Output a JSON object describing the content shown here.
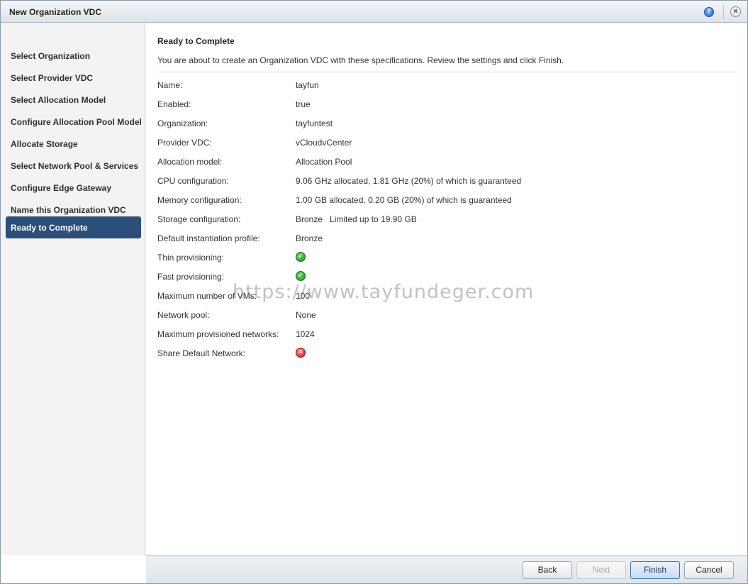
{
  "window": {
    "title": "New Organization VDC",
    "help_glyph": "?",
    "close_glyph": "×"
  },
  "sidebar": {
    "items": [
      {
        "label": "Select Organization"
      },
      {
        "label": "Select Provider VDC"
      },
      {
        "label": "Select Allocation Model"
      },
      {
        "label": "Configure Allocation Pool Model"
      },
      {
        "label": "Allocate Storage"
      },
      {
        "label": "Select Network Pool & Services"
      },
      {
        "label": "Configure Edge Gateway"
      },
      {
        "label": "Name this Organization VDC"
      },
      {
        "label": "Ready to Complete",
        "active": true
      }
    ]
  },
  "main": {
    "heading": "Ready to Complete",
    "intro": "You are about to create an Organization VDC with these specifications. Review the settings and click Finish.",
    "specs": [
      {
        "label": "Name:",
        "value": "tayfun"
      },
      {
        "label": "Enabled:",
        "value": "true"
      },
      {
        "label": "Organization:",
        "value": "tayfuntest"
      },
      {
        "label": "Provider VDC:",
        "value": "vCloudvCenter"
      },
      {
        "label": "Allocation model:",
        "value": "Allocation Pool"
      },
      {
        "label": "CPU configuration:",
        "value": "9.06 GHz allocated, 1.81 GHz (20%) of which is guaranteed"
      },
      {
        "label": "Memory configuration:",
        "value": "1.00 GB allocated, 0.20 GB (20%) of which is guaranteed"
      },
      {
        "label": "Storage configuration:",
        "value": "Bronze   Limited up to 19.90 GB"
      },
      {
        "label": "Default instantiation profile:",
        "value": "Bronze"
      },
      {
        "label": "Thin provisioning:",
        "icon": "check-circle-icon",
        "status": true
      },
      {
        "label": "Fast provisioning:",
        "icon": "check-circle-icon",
        "status": true
      },
      {
        "label": "Maximum number of VMs:",
        "value": "100"
      },
      {
        "label": "Network pool:",
        "value": "None"
      },
      {
        "label": "Maximum provisioned networks:",
        "value": "1024"
      },
      {
        "label": "Share Default Network:",
        "icon": "error-circle-icon",
        "status": false
      }
    ],
    "watermark": "https://www.tayfundeger.com"
  },
  "footer": {
    "back_label": "Back",
    "next_label": "Next",
    "finish_label": "Finish",
    "cancel_label": "Cancel"
  },
  "colors": {
    "active_nav": "#2c4f7a",
    "ok": "#1e8f2a",
    "error": "#c81e1e"
  }
}
